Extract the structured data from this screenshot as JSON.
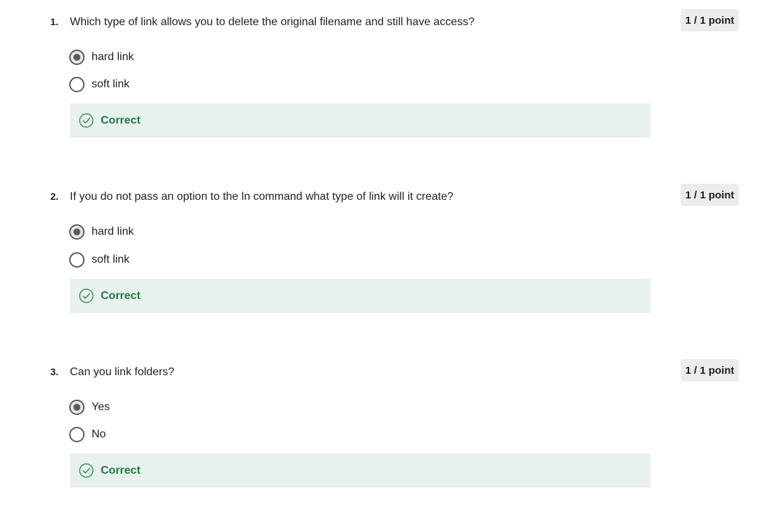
{
  "questions": [
    {
      "number": "1.",
      "text": "Which type of link allows you to delete the original filename and still have access?",
      "score": "1 / 1 point",
      "options": [
        {
          "label": "hard link",
          "selected": true
        },
        {
          "label": "soft link",
          "selected": false
        }
      ],
      "feedback": "Correct"
    },
    {
      "number": "2.",
      "text": "If you do not pass an option to the ln command what type of link will it create?",
      "score": "1 / 1 point",
      "options": [
        {
          "label": "hard link",
          "selected": true
        },
        {
          "label": "soft link",
          "selected": false
        }
      ],
      "feedback": "Correct"
    },
    {
      "number": "3.",
      "text": "Can you link folders?",
      "score": "1 / 1 point",
      "options": [
        {
          "label": "Yes",
          "selected": true
        },
        {
          "label": "No",
          "selected": false
        }
      ],
      "feedback": "Correct"
    }
  ],
  "colors": {
    "feedback_bg": "#e8f1ee",
    "correct_green": "#1d7a47",
    "score_badge_bg": "#ececec",
    "radio_border": "#5b5b5b"
  },
  "icons": {
    "feedback": "check-circle-icon"
  }
}
